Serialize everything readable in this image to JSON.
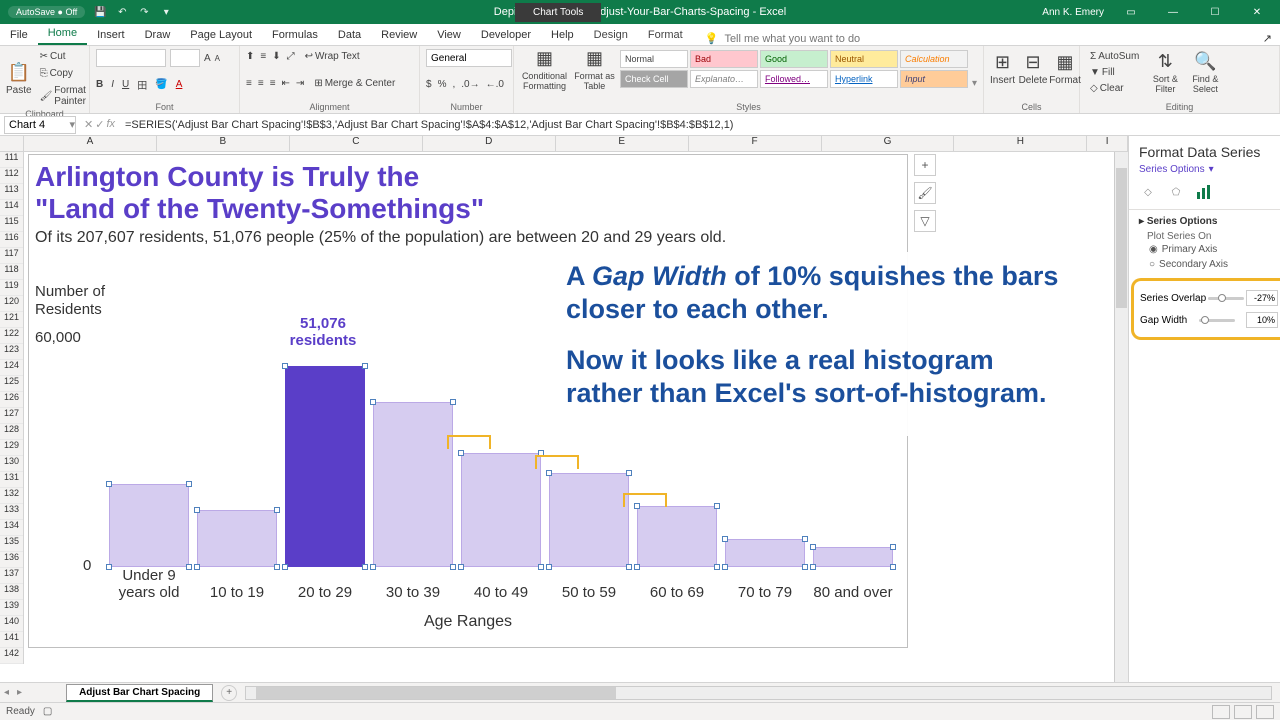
{
  "titlebar": {
    "autosave": "AutoSave ● Off",
    "doc": "Depict-Data-Studio_Adjust-Your-Bar-Charts-Spacing  -  Excel",
    "chart_tools": "Chart Tools",
    "user": "Ann K. Emery"
  },
  "tabs": {
    "file": "File",
    "home": "Home",
    "insert": "Insert",
    "draw": "Draw",
    "pagelayout": "Page Layout",
    "formulas": "Formulas",
    "data": "Data",
    "review": "Review",
    "view": "View",
    "developer": "Developer",
    "help": "Help",
    "design": "Design",
    "format": "Format",
    "tellme_placeholder": "Tell me what you want to do",
    "share": "Share"
  },
  "ribbon": {
    "clipboard": {
      "paste": "Paste",
      "cut": "Cut",
      "copy": "Copy",
      "painter": "Format Painter",
      "label": "Clipboard"
    },
    "font": {
      "label": "Font"
    },
    "alignment": {
      "wrap": "Wrap Text",
      "merge": "Merge & Center",
      "label": "Alignment"
    },
    "number": {
      "general": "General",
      "label": "Number"
    },
    "styles": {
      "cond": "Conditional Formatting",
      "table": "Format as Table",
      "label": "Styles",
      "normal": "Normal",
      "bad": "Bad",
      "good": "Good",
      "neutral": "Neutral",
      "calc": "Calculation",
      "check": "Check Cell",
      "expl": "Explanato…",
      "follow": "Followed…",
      "hyper": "Hyperlink",
      "input": "Input"
    },
    "cells": {
      "insert": "Insert",
      "delete": "Delete",
      "format": "Format",
      "label": "Cells"
    },
    "editing": {
      "sum": "AutoSum",
      "fill": "Fill",
      "clear": "Clear",
      "sort": "Sort & Filter",
      "find": "Find & Select",
      "label": "Editing"
    }
  },
  "formula_bar": {
    "namebox": "Chart 4",
    "formula": "=SERIES('Adjust Bar Chart Spacing'!$B$3,'Adjust Bar Chart Spacing'!$A$4:$A$12,'Adjust Bar Chart Spacing'!$B$4:$B$12,1)"
  },
  "cols": [
    "A",
    "B",
    "C",
    "D",
    "E",
    "F",
    "G",
    "H",
    "I"
  ],
  "rows": [
    "111",
    "112",
    "113",
    "114",
    "115",
    "116",
    "117",
    "118",
    "119",
    "120",
    "121",
    "122",
    "123",
    "124",
    "125",
    "126",
    "127",
    "128",
    "129",
    "130",
    "131",
    "132",
    "133",
    "134",
    "135",
    "136",
    "137",
    "138",
    "139",
    "140",
    "141",
    "142"
  ],
  "chart_data": {
    "type": "bar",
    "title_line1": "Arlington County is Truly the",
    "title_line2": "\"Land of the Twenty-Somethings\"",
    "subtitle": "Of its 207,607 residents, 51,076 people (25% of the population) are between 20 and 29 years old.",
    "ylabel_line1": "Number of",
    "ylabel_line2": "Residents",
    "ylim": [
      0,
      60000
    ],
    "ymin_label": "0",
    "ymax_label": "60,000",
    "xlabel": "Age Ranges",
    "highlight_index": 2,
    "highlight_label_line1": "51,076",
    "highlight_label_line2": "residents",
    "categories": [
      "Under 9 years old",
      "10 to 19",
      "20 to 29",
      "30 to 39",
      "40 to 49",
      "50 to 59",
      "60 to 69",
      "70 to 79",
      "80 and over"
    ],
    "values": [
      21000,
      14500,
      51076,
      42000,
      29000,
      24000,
      15500,
      7000,
      5000
    ]
  },
  "overlay": {
    "p1a": "A ",
    "p1b": "Gap Width",
    "p1c": " of 10% squishes the bars closer to each other.",
    "p2": "Now it looks like a real histogram rather than Excel's sort-of-histogram."
  },
  "format_pane": {
    "title": "Format Data Series",
    "subtitle": "Series Options",
    "section": "Series Options",
    "plot_on": "Plot Series On",
    "primary": "Primary Axis",
    "secondary": "Secondary Axis",
    "overlap": "Series Overlap",
    "overlap_val": "-27%",
    "gap": "Gap Width",
    "gap_val": "10%"
  },
  "sheet_tab": "Adjust Bar Chart Spacing",
  "status": {
    "ready": "Ready"
  }
}
